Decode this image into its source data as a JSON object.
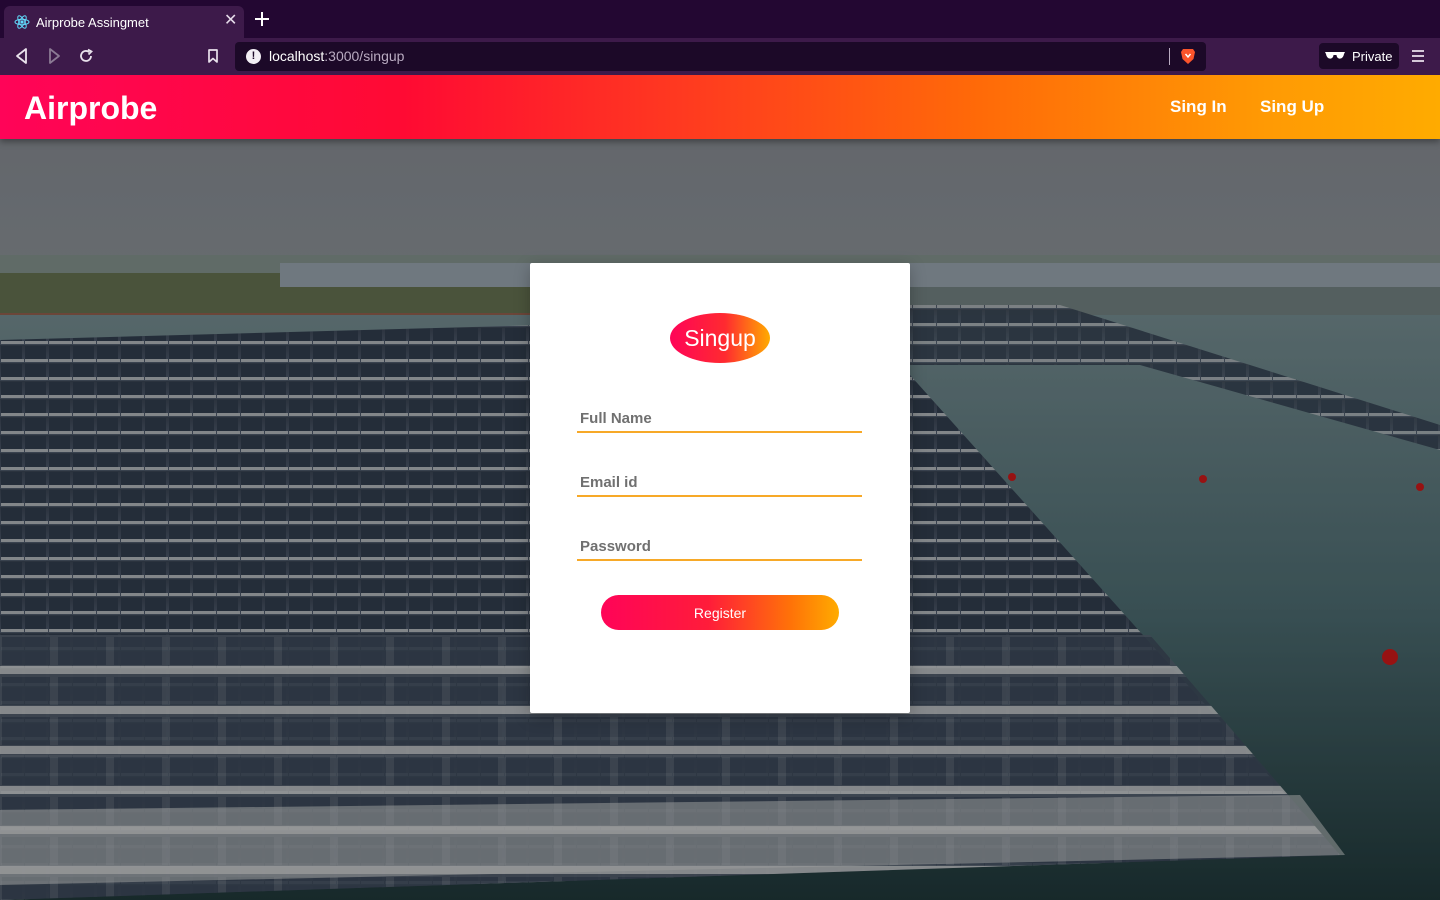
{
  "browser": {
    "tab_title": "Airprobe Assingmet",
    "tab_favicon": "react-atom-icon",
    "url_host": "localhost",
    "url_path": ":3000/singup",
    "private_label": "Private"
  },
  "navbar": {
    "brand": "Airprobe",
    "links": [
      {
        "label": "Sing In"
      },
      {
        "label": "Sing Up"
      }
    ]
  },
  "form": {
    "title": "Singup",
    "fields": [
      {
        "placeholder": "Full Name",
        "value": ""
      },
      {
        "placeholder": "Email id",
        "value": ""
      },
      {
        "placeholder": "Password",
        "value": ""
      }
    ],
    "submit_label": "Register"
  },
  "colors": {
    "chrome_dark": "#230732",
    "chrome_tab": "#3d1a4a",
    "gradient_start": "#ff0458",
    "gradient_end": "#ffab00",
    "field_underline": "#f7a928"
  }
}
